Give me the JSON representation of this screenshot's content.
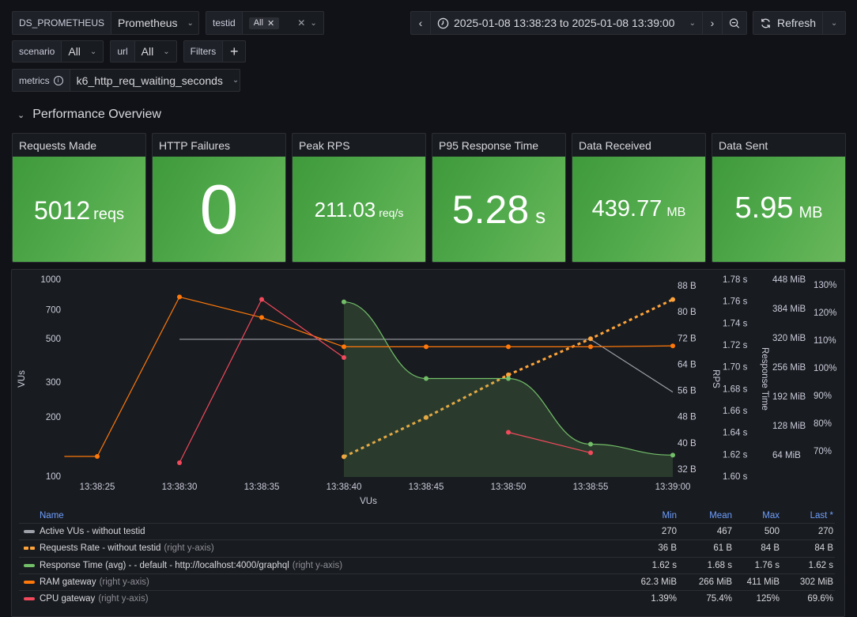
{
  "variables": {
    "datasource": {
      "label": "DS_PROMETHEUS",
      "value": "Prometheus"
    },
    "testid": {
      "label": "testid",
      "chip": "All"
    },
    "scenario": {
      "label": "scenario",
      "value": "All"
    },
    "url": {
      "label": "url",
      "value": "All"
    },
    "filters": {
      "label": "Filters"
    },
    "metrics": {
      "label": "metrics",
      "value": "k6_http_req_waiting_seconds"
    }
  },
  "timepicker": {
    "range": "2025-01-08 13:38:23 to 2025-01-08 13:39:00",
    "refresh_label": "Refresh"
  },
  "section": {
    "title": "Performance Overview"
  },
  "stats": [
    {
      "title": "Requests Made",
      "value": "5012",
      "unit": "reqs"
    },
    {
      "title": "HTTP Failures",
      "value": "0",
      "unit": ""
    },
    {
      "title": "Peak RPS",
      "value": "211.03",
      "unit": "req/s"
    },
    {
      "title": "P95 Response Time",
      "value": "5.28",
      "unit": "s"
    },
    {
      "title": "Data Received",
      "value": "439.77",
      "unit": "MB"
    },
    {
      "title": "Data Sent",
      "value": "5.95",
      "unit": "MB"
    }
  ],
  "colors": {
    "stat_green": "#56a64b",
    "vus": "#9fa1aa",
    "requests": "#ffa43b",
    "response": "#73bf69",
    "ram": "#ff780a",
    "cpu": "#f2495c"
  },
  "chart_data": {
    "type": "line",
    "xlabel": "VUs",
    "x_ticks": [
      "13:38:25",
      "13:38:30",
      "13:38:35",
      "13:38:40",
      "13:38:45",
      "13:38:50",
      "13:38:55",
      "13:39:00"
    ],
    "x_range": [
      "13:38:23",
      "13:39:00"
    ],
    "axes": [
      {
        "id": "vus",
        "label": "VUs",
        "scale": "log",
        "range": [
          100,
          1000
        ],
        "ticks": [
          "100",
          "200",
          "300",
          "500",
          "700",
          "1000"
        ],
        "position": "left"
      },
      {
        "id": "bytes",
        "label": "",
        "range": [
          32,
          88
        ],
        "ticks": [
          "32 B",
          "40 B",
          "48 B",
          "56 B",
          "64 B",
          "72 B",
          "80 B",
          "88 B"
        ],
        "position": "right"
      },
      {
        "id": "seconds",
        "label": "RPS",
        "range": [
          1.6,
          1.78
        ],
        "ticks": [
          "1.60 s",
          "1.62 s",
          "1.64 s",
          "1.66 s",
          "1.68 s",
          "1.70 s",
          "1.72 s",
          "1.74 s",
          "1.76 s",
          "1.78 s"
        ],
        "position": "right"
      },
      {
        "id": "mib",
        "label": "Response Time",
        "range": [
          0,
          448
        ],
        "ticks": [
          "64 MiB",
          "128 MiB",
          "192 MiB",
          "256 MiB",
          "320 MiB",
          "384 MiB",
          "448 MiB"
        ],
        "position": "right"
      },
      {
        "id": "pct",
        "label": "",
        "range": [
          70,
          130
        ],
        "ticks": [
          "70%",
          "80%",
          "90%",
          "100%",
          "110%",
          "120%",
          "130%"
        ],
        "position": "right"
      }
    ],
    "series": [
      {
        "name": "Active VUs - without testid",
        "axis": "vus",
        "color": "#9fa1aa",
        "style": "solid",
        "points": [
          [
            "13:38:30",
            500
          ],
          [
            "13:38:55",
            500
          ],
          [
            "13:39:00",
            270
          ]
        ]
      },
      {
        "name": "Requests Rate - without testid",
        "axis": "bytes",
        "color": "#ffa43b",
        "style": "dashed",
        "points": [
          [
            "13:38:40",
            36
          ],
          [
            "13:38:45",
            48
          ],
          [
            "13:38:50",
            61
          ],
          [
            "13:38:55",
            72
          ],
          [
            "13:39:00",
            84
          ]
        ]
      },
      {
        "name": "Response Time (avg) - - default - http://localhost:4000/graphql",
        "axis": "seconds",
        "color": "#73bf69",
        "style": "smooth-fill",
        "points": [
          [
            "13:38:40",
            1.76
          ],
          [
            "13:38:45",
            1.69
          ],
          [
            "13:38:50",
            1.69
          ],
          [
            "13:38:55",
            1.63
          ],
          [
            "13:39:00",
            1.62
          ]
        ]
      },
      {
        "name": "RAM gateway",
        "axis": "mib",
        "color": "#ff780a",
        "style": "solid",
        "points": [
          [
            "13:38:23",
            62.3
          ],
          [
            "13:38:25",
            62.3
          ],
          [
            "13:38:30",
            411
          ],
          [
            "13:38:35",
            366
          ],
          [
            "13:38:40",
            302
          ],
          [
            "13:38:45",
            302
          ],
          [
            "13:38:50",
            302
          ],
          [
            "13:38:55",
            302
          ],
          [
            "13:39:00",
            304
          ]
        ]
      },
      {
        "name": "CPU gateway",
        "axis": "pct",
        "color": "#f2495c",
        "style": "solid",
        "segments": [
          [
            [
              "13:38:30",
              66
            ],
            [
              "13:38:35",
              125
            ],
            [
              "13:38:40",
              104
            ]
          ],
          [
            [
              "13:38:50",
              77
            ],
            [
              "13:38:55",
              69.6
            ]
          ]
        ]
      }
    ]
  },
  "legend": {
    "headers": {
      "name": "Name",
      "min": "Min",
      "mean": "Mean",
      "max": "Max",
      "last": "Last *"
    },
    "rows": [
      {
        "name": "Active VUs - without testid",
        "suffix": "",
        "swatch": "solid",
        "color": "#9fa1aa",
        "min": "270",
        "mean": "467",
        "max": "500",
        "last": "270"
      },
      {
        "name": "Requests Rate - without testid",
        "suffix": "(right y-axis)",
        "swatch": "dashed",
        "color": "#ffa43b",
        "min": "36 B",
        "mean": "61 B",
        "max": "84 B",
        "last": "84 B"
      },
      {
        "name": "Response Time (avg) - - default - http://localhost:4000/graphql",
        "suffix": "(right y-axis)",
        "swatch": "solid",
        "color": "#73bf69",
        "min": "1.62 s",
        "mean": "1.68 s",
        "max": "1.76 s",
        "last": "1.62 s"
      },
      {
        "name": "RAM gateway",
        "suffix": "(right y-axis)",
        "swatch": "solid",
        "color": "#ff780a",
        "min": "62.3 MiB",
        "mean": "266 MiB",
        "max": "411 MiB",
        "last": "302 MiB"
      },
      {
        "name": "CPU gateway",
        "suffix": "(right y-axis)",
        "swatch": "solid",
        "color": "#f2495c",
        "min": "1.39%",
        "mean": "75.4%",
        "max": "125%",
        "last": "69.6%"
      }
    ]
  }
}
